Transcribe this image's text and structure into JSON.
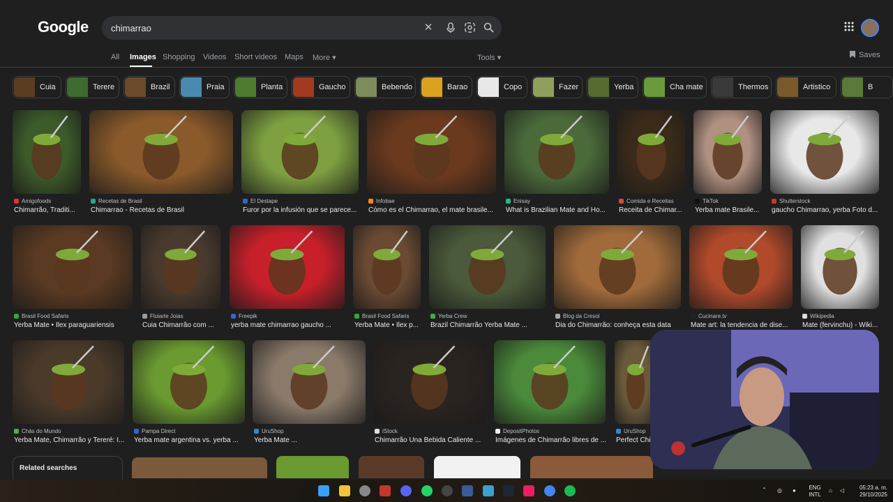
{
  "header": {
    "logo": "Google",
    "search_value": "chimarrao"
  },
  "tabs": [
    {
      "label": "All"
    },
    {
      "label": "Images"
    },
    {
      "label": "Shopping"
    },
    {
      "label": "Videos"
    },
    {
      "label": "Short videos"
    },
    {
      "label": "Maps"
    },
    {
      "label": "More ▾"
    }
  ],
  "tools_label": "Tools ▾",
  "saves_label": "Saves",
  "chips": [
    {
      "label": "Cuia",
      "color": "#5b3d22"
    },
    {
      "label": "Terere",
      "color": "#3e6b2e"
    },
    {
      "label": "Brazil",
      "color": "#6b4a2c"
    },
    {
      "label": "Praia",
      "color": "#4a8ab0"
    },
    {
      "label": "Planta",
      "color": "#4d7c2f"
    },
    {
      "label": "Gaucho",
      "color": "#a33a1e"
    },
    {
      "label": "Bebendo",
      "color": "#7d8c5a"
    },
    {
      "label": "Barao",
      "color": "#d9a21f"
    },
    {
      "label": "Copo",
      "color": "#e8e8e8"
    },
    {
      "label": "Fazer",
      "color": "#8fa05b"
    },
    {
      "label": "Yerba",
      "color": "#556b30"
    },
    {
      "label": "Cha mate",
      "color": "#6a9a3a"
    },
    {
      "label": "Thermos",
      "color": "#3a3a3a"
    },
    {
      "label": "Artistico",
      "color": "#7a5a2a"
    },
    {
      "label": "B",
      "color": "#5a7a3a"
    }
  ],
  "results": [
    {
      "source": "Amigofoods",
      "title": "Chimarrão, Traditi...",
      "color": "#3c5a2a",
      "icon": "#d33"
    },
    {
      "source": "Recetas de Brasil",
      "title": "Chimarrao - Recetas de Brasil",
      "color": "#8a5a2a",
      "icon": "#2a8"
    },
    {
      "source": "El Destape",
      "title": "Furor por la infusión que se parece...",
      "color": "#7ea040",
      "icon": "#36c"
    },
    {
      "source": "Infobae",
      "title": "Cómo es el Chimarrao, el mate brasile...",
      "color": "#6b3a1e",
      "icon": "#f80"
    },
    {
      "source": "Enisay",
      "title": "What is Brazilian Mate and Ho...",
      "color": "#4a6a3a",
      "icon": "#2b8"
    },
    {
      "source": "Comida e Receitas",
      "title": "Receita de Chimar...",
      "color": "#3a2a1a",
      "icon": "#d44"
    },
    {
      "source": "TikTok",
      "title": "Yerba mate Brasile...",
      "color": "#b09080",
      "icon": "#111"
    },
    {
      "source": "Shutterstock",
      "title": "gaucho Chimarrao, yerba Foto d...",
      "color": "#e8e8e8",
      "icon": "#c33"
    },
    {
      "source": "Brasil Food Safaris",
      "title": "Yerba Mate • Ilex paraguariensis",
      "color": "#5a3a22",
      "icon": "#3a3"
    },
    {
      "source": "Fluiarte Joias",
      "title": "Cuia Chimarrão com ...",
      "color": "#4a3a2e",
      "icon": "#999"
    },
    {
      "source": "Freepik",
      "title": "yerba mate chimarrao gaucho ...",
      "color": "#c8202a",
      "icon": "#36c"
    },
    {
      "source": "Brasil Food Safaris",
      "title": "Yerba Mate • Ilex p...",
      "color": "#6a4a32",
      "icon": "#3a3"
    },
    {
      "source": "Yerba Crew",
      "title": "Brazil Chimarrão Yerba Mate ...",
      "color": "#4a5a3a",
      "icon": "#4a4"
    },
    {
      "source": "Blog da Cresol",
      "title": "Dia do Chimarrão: conheça esta data",
      "color": "#a06a3a",
      "icon": "#aaa"
    },
    {
      "source": "Cucinare.tv",
      "title": "Mate art: la tendencia de dise...",
      "color": "#b04a2a",
      "icon": "#222"
    },
    {
      "source": "Wikipedia",
      "title": "Mate (fervinchu) - Wiki...",
      "color": "#e0e0e0",
      "icon": "#ddd"
    },
    {
      "source": "Chás do Mundo",
      "title": "Yerba Mate, Chimarrão y Tereré: I...",
      "color": "#4a3a2a",
      "icon": "#5a5"
    },
    {
      "source": "Pampa Direct",
      "title": "Yerba mate argentina vs. yerba ...",
      "color": "#6a9a30",
      "icon": "#36c"
    },
    {
      "source": "UruShop",
      "title": "Yerba Mate ...",
      "color": "#8a7a6a",
      "icon": "#38c"
    },
    {
      "source": "iStock",
      "title": "Chimarrão Una Bebida Caliente ...",
      "color": "#2a2420",
      "icon": "#ddd"
    },
    {
      "source": "DepositPhotos",
      "title": "Imágenes de Chimarrão libres de ...",
      "color": "#4a8a3a",
      "icon": "#eee"
    },
    {
      "source": "UruShop",
      "title": "Perfect Chi...",
      "color": "#6a5a3a",
      "icon": "#38c"
    }
  ],
  "related_searches": "Related searches",
  "taskbar": {
    "lang1": "ENG",
    "lang2": "INTL",
    "time": "05:23 a. m.",
    "date": "29/10/2025"
  }
}
